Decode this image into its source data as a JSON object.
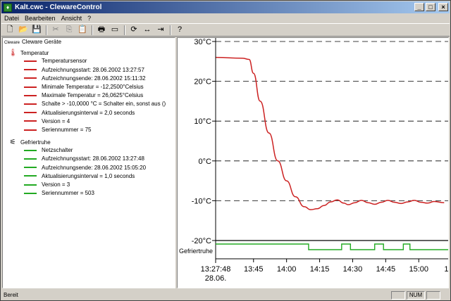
{
  "window": {
    "title": "Kalt.cwc - ClewareControl"
  },
  "menu": [
    "Datei",
    "Bearbeiten",
    "Ansicht",
    "?"
  ],
  "toolbar": [
    {
      "name": "new-file-icon",
      "glyph": "🗋",
      "enabled": true
    },
    {
      "name": "open-folder-icon",
      "glyph": "📂",
      "enabled": true
    },
    {
      "name": "save-icon",
      "glyph": "💾",
      "enabled": true
    },
    {
      "sep": true
    },
    {
      "name": "cut-icon",
      "glyph": "✂",
      "enabled": false
    },
    {
      "name": "copy-icon",
      "glyph": "⎘",
      "enabled": false
    },
    {
      "name": "paste-icon",
      "glyph": "📋",
      "enabled": false
    },
    {
      "sep": true
    },
    {
      "name": "print-icon",
      "glyph": "🖶",
      "enabled": true
    },
    {
      "name": "window-icon",
      "glyph": "▭",
      "enabled": true
    },
    {
      "sep": true
    },
    {
      "name": "refresh-icon",
      "glyph": "⟳",
      "enabled": true
    },
    {
      "name": "expand-icon",
      "glyph": "↔",
      "enabled": true
    },
    {
      "name": "collapse-icon",
      "glyph": "⇥",
      "enabled": true
    },
    {
      "sep": true
    },
    {
      "name": "help-icon",
      "glyph": "?",
      "enabled": true
    }
  ],
  "tree": {
    "root_tag": "Cleware",
    "root_label": "Cleware Geräte",
    "devices": [
      {
        "label": "Temperatur",
        "icon": "thermometer-icon",
        "color": "#cc2222",
        "items": [
          "Temperatursensor",
          "Aufzeichnungsstart: 28.06.2002 13:27:57",
          "Aufzeichnungsende: 28.06.2002 15:11:32",
          "Minimale Temperatur = -12,2500°Celsius",
          "Maximale Temperatur = 26,0625°Celsius",
          "Schalte > -10,0000 °C = Schalter ein, sonst aus ()",
          "Aktualisierungsinterval = 2,0 seconds",
          "Version = 4",
          "Seriennummer = 75"
        ]
      },
      {
        "label": "Gefriertruhe",
        "icon": "switch-icon",
        "color": "#22aa22",
        "items": [
          "Netzschalter",
          "Aufzeichnungsstart: 28.06.2002 13:27:48",
          "Aufzeichnungsende: 28.06.2002 15:05:20",
          "Aktualisierungsinterval = 1,0 seconds",
          "Version = 3",
          "Seriennummer = 503"
        ]
      }
    ]
  },
  "status": {
    "text": "Bereit",
    "indicators": [
      "",
      "NUM",
      ""
    ]
  },
  "chart_data": {
    "type": "line",
    "y_ticks": [
      "30°C",
      "20°C",
      "10°C",
      "0°C",
      "-10°C",
      "-20°C"
    ],
    "y_values": [
      30,
      20,
      10,
      0,
      -10,
      -20
    ],
    "ylim": [
      -20,
      30
    ],
    "x_ticks": [
      "13:27:48",
      "13:45",
      "14:00",
      "14:15",
      "14:30",
      "14:45",
      "15:00",
      "15:1"
    ],
    "x_tick_sub": "28.06.",
    "grid": "dashed horizontal",
    "series": [
      {
        "kind": "temperature",
        "color": "#cc2222",
        "x": [
          "13:27:57",
          "13:40",
          "13:43",
          "13:45",
          "13:48",
          "13:52",
          "13:56",
          "14:00",
          "14:04",
          "14:08",
          "14:11",
          "14:14",
          "14:17",
          "14:20",
          "14:23",
          "14:26",
          "14:28",
          "14:31",
          "14:34",
          "14:37",
          "14:40",
          "14:43",
          "14:46",
          "14:49",
          "14:52",
          "14:55",
          "14:58",
          "15:01",
          "15:04",
          "15:07",
          "15:11:32"
        ],
        "values": [
          26,
          25.8,
          25.5,
          22,
          15,
          7,
          0,
          -5,
          -9,
          -11.5,
          -12.25,
          -12,
          -11.2,
          -10.3,
          -9.8,
          -10.6,
          -11,
          -10.5,
          -9.9,
          -10.5,
          -10.9,
          -10.4,
          -9.9,
          -10.4,
          -10.7,
          -10.3,
          -9.9,
          -10.4,
          -10.6,
          -10.2,
          -10.5
        ]
      },
      {
        "name": "Gefriertruhe",
        "color": "#22aa22",
        "steps_x": [
          "13:27:48",
          "14:10",
          "14:25",
          "14:29",
          "14:40",
          "14:44",
          "14:53",
          "14:56",
          "15:05:20"
        ],
        "steps_on": [
          1,
          0,
          1,
          0,
          1,
          0,
          1,
          0,
          0
        ]
      }
    ]
  }
}
